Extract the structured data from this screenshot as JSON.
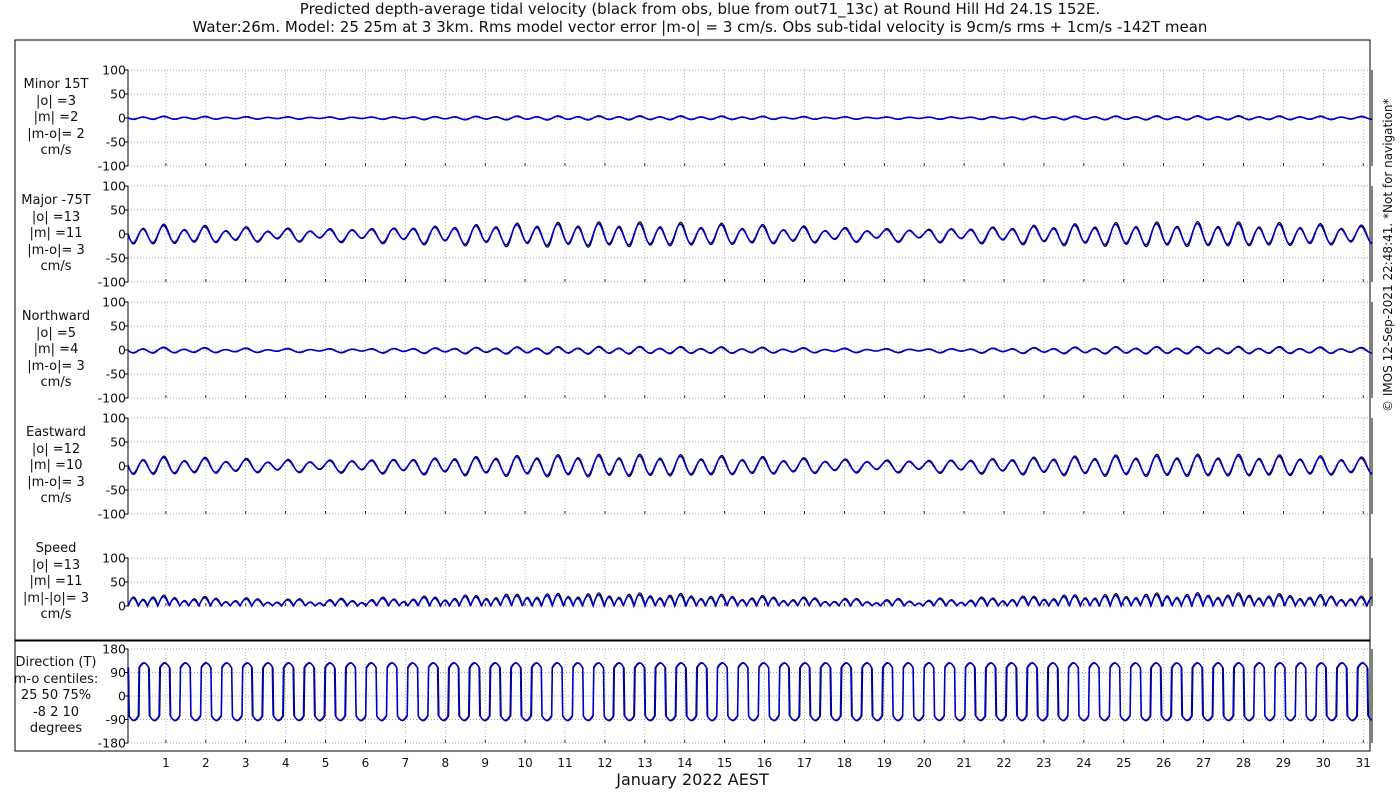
{
  "title": "Predicted depth-average tidal velocity (black from obs, blue from out71_13c) at Round Hill Hd 24.1S 152E.",
  "subtitle": "Water:26m. Model: 25 25m at 3 3km. Rms model vector error |m-o| = 3 cm/s. Obs sub-tidal velocity is 9cm/s rms + 1cm/s -142T mean",
  "credit": "© IMOS 12-Sep-2021 22:48:41. *Not for navigation*",
  "colors": {
    "obs": "#000000",
    "model": "#0000cc",
    "grid": "#8a8a8a",
    "axis": "#000000"
  },
  "chart_data": {
    "type": "line",
    "xlabel": "January 2022 AEST",
    "x_ticks": [
      1,
      2,
      3,
      4,
      5,
      6,
      7,
      8,
      9,
      10,
      11,
      12,
      13,
      14,
      15,
      16,
      17,
      18,
      19,
      20,
      21,
      22,
      23,
      24,
      25,
      26,
      27,
      28,
      29,
      30,
      31
    ],
    "xlim": [
      0.05,
      31.22
    ],
    "grid": true,
    "series_names": [
      "obs",
      "out71_13c"
    ],
    "panels": [
      {
        "id": "minor",
        "label_lines": [
          "Minor 15T",
          "|o| =3",
          "|m| =2",
          "|m-o|= 2",
          "cm/s"
        ],
        "ylim": [
          -100,
          100
        ],
        "yticks": [
          -100,
          -50,
          0,
          50,
          100
        ],
        "tidal": {
          "M2": 3,
          "S2": 1,
          "K1": 1,
          "offset": 0,
          "model_scale": 0.75,
          "model_phase": 0.1
        }
      },
      {
        "id": "major",
        "label_lines": [
          "Major -75T",
          "|o| =13",
          "|m| =11",
          "|m-o|= 3",
          "cm/s"
        ],
        "ylim": [
          -100,
          100
        ],
        "yticks": [
          -100,
          -50,
          0,
          50,
          100
        ],
        "tidal": {
          "M2": 17,
          "S2": 6,
          "K1": 5,
          "offset": -2,
          "model_scale": 0.85,
          "model_phase": 0.12
        }
      },
      {
        "id": "northward",
        "label_lines": [
          "Northward",
          "|o| =5",
          "|m| =4",
          "|m-o|= 3",
          "cm/s"
        ],
        "ylim": [
          -100,
          100
        ],
        "yticks": [
          -100,
          -50,
          0,
          50,
          100
        ],
        "tidal": {
          "M2": 5,
          "S2": 2,
          "K1": 2,
          "offset": -1,
          "model_scale": 0.8,
          "model_phase": 0.15
        }
      },
      {
        "id": "eastward",
        "label_lines": [
          "Eastward",
          "|o| =12",
          "|m| =10",
          "|m-o|= 3",
          "cm/s"
        ],
        "ylim": [
          -100,
          100
        ],
        "yticks": [
          -100,
          -50,
          0,
          50,
          100
        ],
        "tidal": {
          "M2": 16,
          "S2": 5,
          "K1": 4,
          "offset": 0,
          "model_scale": 0.85,
          "model_phase": 0.12
        }
      },
      {
        "id": "speed",
        "label_lines": [
          "Speed",
          "|o| =13",
          "|m| =11",
          "|m|-|o|= 3",
          "cm/s"
        ],
        "ylim": [
          0,
          100
        ],
        "yticks": [
          0,
          50,
          100
        ],
        "tidal": {
          "M2": 17,
          "S2": 6,
          "K1": 5,
          "offset": 0,
          "model_scale": 0.85,
          "model_phase": 0.12,
          "abs": true
        }
      },
      {
        "id": "direction",
        "label_lines": [
          "Direction (T)",
          "m-o centiles:",
          "25  50  75%",
          "-8  2 10",
          "degrees"
        ],
        "ylim": [
          -180,
          180
        ],
        "yticks": [
          -180,
          -90,
          0,
          90,
          180
        ],
        "direction": {
          "major_axis_deg": -75,
          "model_shift_deg": 2
        }
      }
    ]
  }
}
